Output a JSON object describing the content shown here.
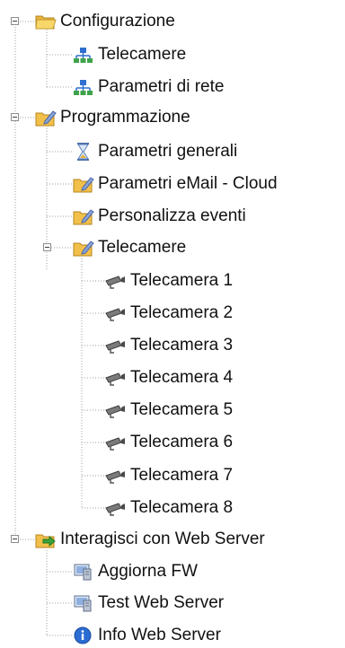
{
  "tree": {
    "configurazione": {
      "label": "Configurazione",
      "icon": "folder-open-icon",
      "children": [
        {
          "label": "Telecamere",
          "icon": "network-icon"
        },
        {
          "label": "Parametri di rete",
          "icon": "network-icon"
        }
      ]
    },
    "programmazione": {
      "label": "Programmazione",
      "icon": "folder-edit-icon",
      "children": [
        {
          "label": "Parametri generali",
          "icon": "hourglass-icon"
        },
        {
          "label": "Parametri eMail - Cloud",
          "icon": "folder-edit-icon"
        },
        {
          "label": "Personalizza eventi",
          "icon": "folder-edit-icon"
        }
      ],
      "telecamere": {
        "label": "Telecamere",
        "icon": "folder-edit-icon",
        "cameras": [
          "Telecamera 1",
          "Telecamera 2",
          "Telecamera 3",
          "Telecamera 4",
          "Telecamera 5",
          "Telecamera 6",
          "Telecamera 7",
          "Telecamera 8"
        ],
        "camera_icon": "cctv-camera-icon"
      }
    },
    "webserver": {
      "label": "Interagisci con Web Server",
      "icon": "folder-arrow-icon",
      "children": [
        {
          "label": "Aggiorna FW",
          "icon": "server-monitor-icon"
        },
        {
          "label": "Test Web Server",
          "icon": "server-monitor-icon"
        },
        {
          "label": "Info Web Server",
          "icon": "info-icon"
        }
      ]
    }
  },
  "colors": {
    "folder": "#f2c04a",
    "pencil": "#5a79b8",
    "network": "#2f6fcf",
    "camera": "#6a6a6a",
    "info": "#2b6cd4",
    "arrow": "#3aa33a"
  }
}
